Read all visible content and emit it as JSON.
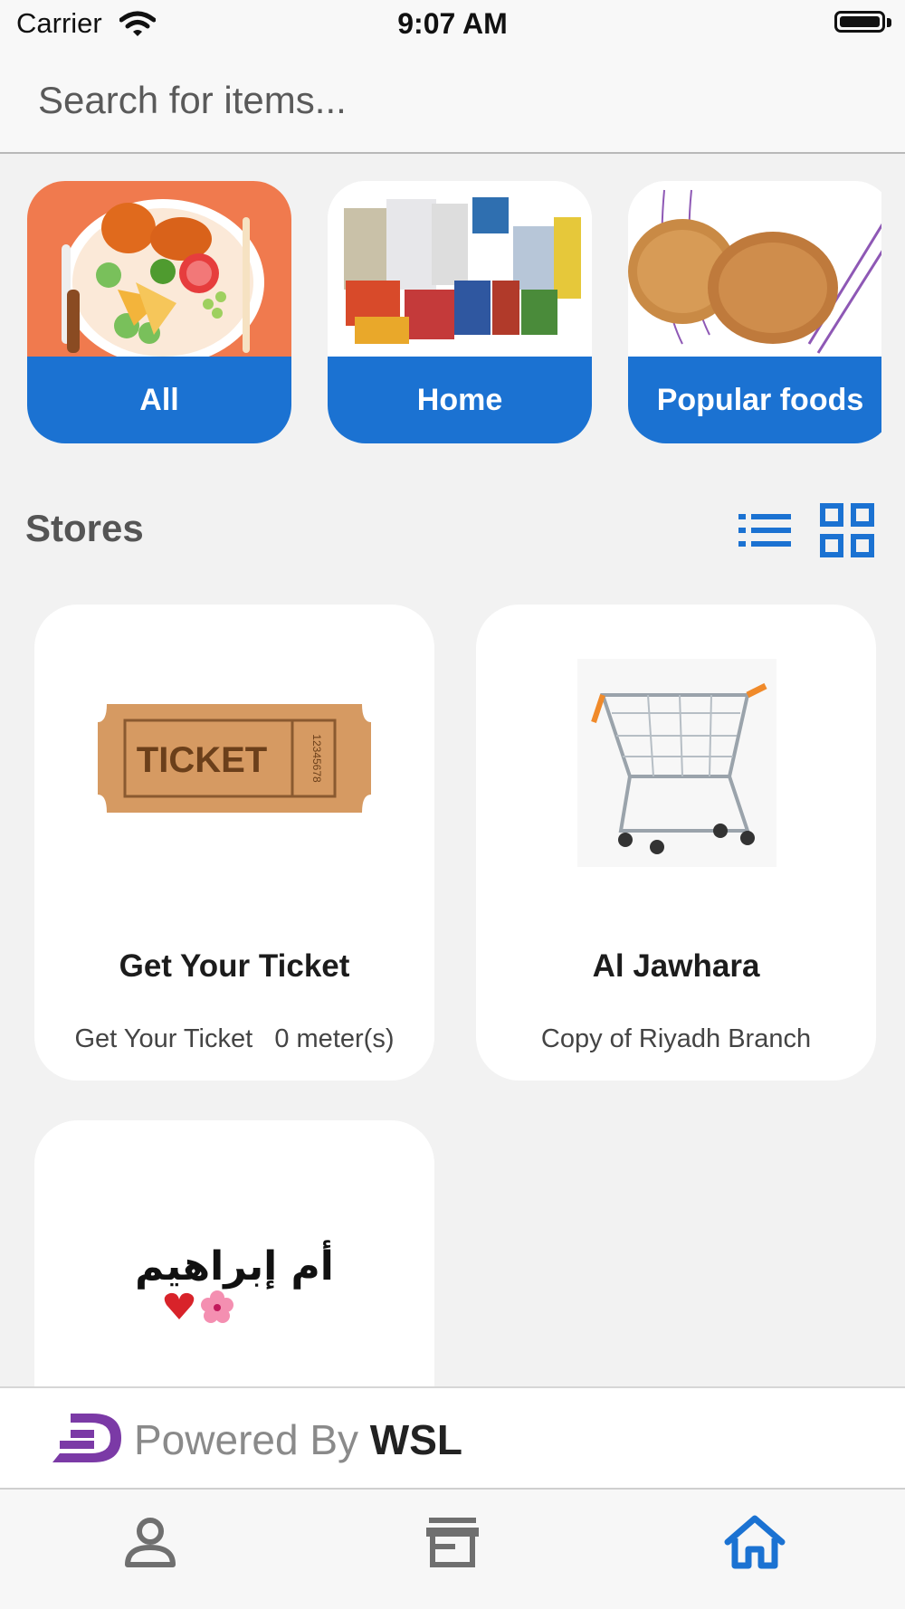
{
  "status_bar": {
    "carrier": "Carrier",
    "time": "9:07 AM"
  },
  "search": {
    "placeholder": "Search for items..."
  },
  "categories": [
    {
      "label": "All",
      "image": "meal-plate-illustration"
    },
    {
      "label": "Home",
      "image": "grocery-products-photo"
    },
    {
      "label": "Popular foods",
      "image": "bread-loaves-photo"
    }
  ],
  "stores_section": {
    "title": "Stores",
    "view_icons": [
      "list-view-icon",
      "grid-view-icon"
    ],
    "active_view": "grid"
  },
  "stores": [
    {
      "name": "Get Your Ticket",
      "subtitle": "Get Your Ticket",
      "distance": "0 meter(s)",
      "image": "ticket-image",
      "image_text": "TICKET",
      "image_serial": "12345678"
    },
    {
      "name": "Al Jawhara",
      "subtitle": "Copy of Riyadh Branch",
      "distance": "",
      "image": "shopping-cart-image"
    },
    {
      "name": "",
      "subtitle": "",
      "distance": "",
      "image": "arabic-logo-image",
      "image_text": "أم إبراهيم"
    }
  ],
  "footer": {
    "powered_by": "Powered By",
    "brand": "WSL"
  },
  "tab_bar": {
    "tabs": [
      "profile-tab",
      "stores-tab",
      "home-tab"
    ],
    "active": "home-tab"
  },
  "colors": {
    "accent": "#1b72d2",
    "background": "#f2f2f2",
    "card": "#ffffff",
    "brand_logo": "#7b3aa6"
  }
}
